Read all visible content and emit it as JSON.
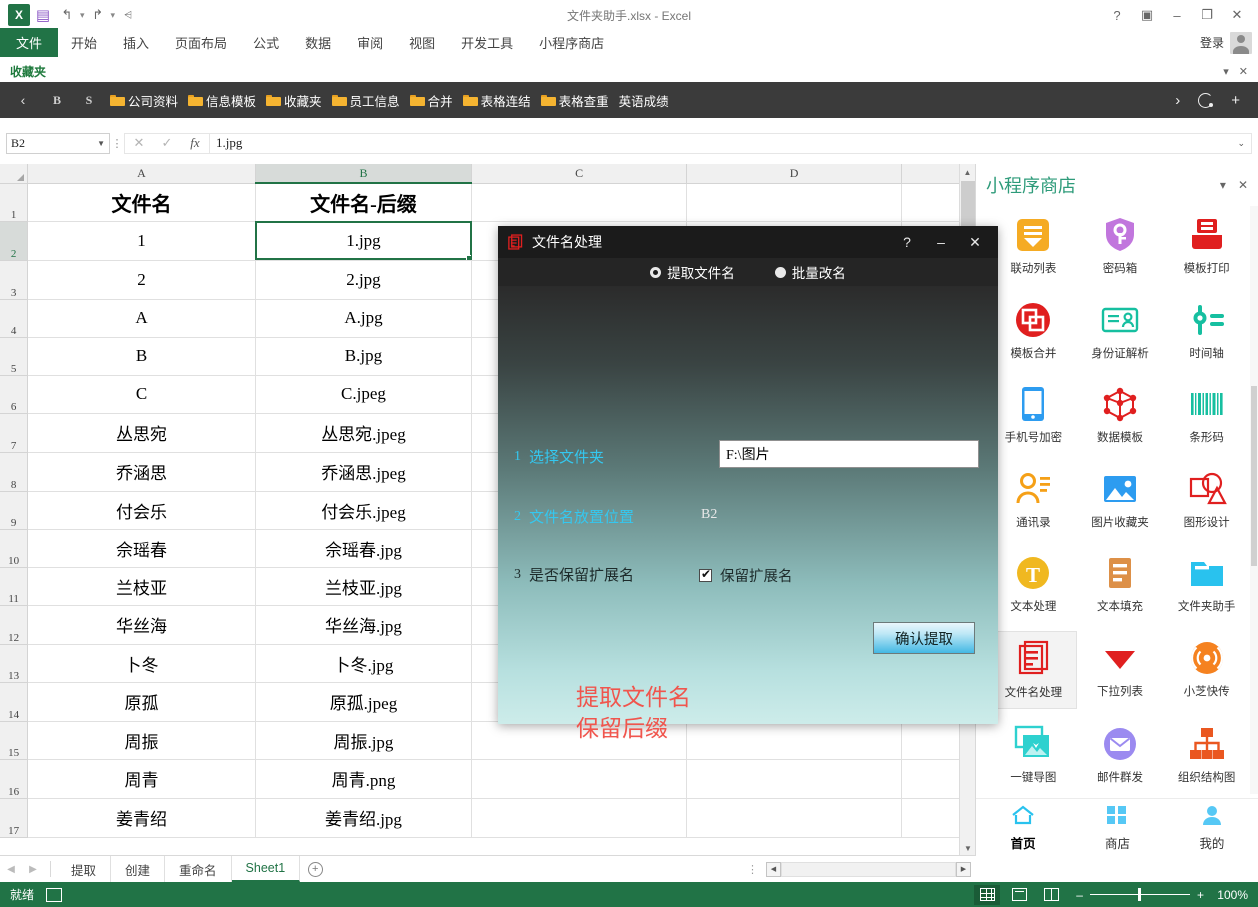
{
  "window": {
    "title": "文件夹助手.xlsx - Excel",
    "quick_access": [
      "save-icon",
      "undo-icon",
      "redo-icon",
      "customize-icon"
    ],
    "controls": {
      "help": "?",
      "ribbon_display": "▣",
      "minimize": "–",
      "restore": "❐",
      "close": "✕"
    }
  },
  "ribbon": {
    "tabs": [
      "文件",
      "开始",
      "插入",
      "页面布局",
      "公式",
      "数据",
      "审阅",
      "视图",
      "开发工具",
      "小程序商店"
    ],
    "active_tab": "文件",
    "signin_label": "登录"
  },
  "favorites": {
    "label": "收藏夹",
    "nav_back": "‹",
    "letters": [
      "B",
      "S"
    ],
    "items": [
      "公司资料",
      "信息模板",
      "收藏夹",
      "员工信息",
      "合并",
      "表格连结",
      "表格查重"
    ],
    "plain_item": "英语成绩",
    "nav_forward": "›",
    "refresh": "refresh-icon",
    "add": "+"
  },
  "formula_bar": {
    "name_box": "B2",
    "cancel": "✕",
    "enter": "✓",
    "fx": "fx",
    "content": "1.jpg",
    "expand_caret": "⌄"
  },
  "sheet": {
    "columns": [
      "A",
      "B",
      "C",
      "D"
    ],
    "selected_column": "B",
    "selected_row": "2",
    "selected_cell": "B2",
    "rows": [
      {
        "n": "1",
        "a": "文件名",
        "b": "文件名-后缀"
      },
      {
        "n": "2",
        "a": "1",
        "b": "1.jpg"
      },
      {
        "n": "3",
        "a": "2",
        "b": "2.jpg"
      },
      {
        "n": "4",
        "a": "A",
        "b": "A.jpg"
      },
      {
        "n": "5",
        "a": "B",
        "b": "B.jpg"
      },
      {
        "n": "6",
        "a": "C",
        "b": "C.jpeg"
      },
      {
        "n": "7",
        "a": "丛思宛",
        "b": "丛思宛.jpeg"
      },
      {
        "n": "8",
        "a": "乔涵思",
        "b": "乔涵思.jpeg"
      },
      {
        "n": "9",
        "a": "付会乐",
        "b": "付会乐.jpeg"
      },
      {
        "n": "10",
        "a": "佘瑶春",
        "b": "佘瑶春.jpg"
      },
      {
        "n": "11",
        "a": "兰枝亚",
        "b": "兰枝亚.jpg"
      },
      {
        "n": "12",
        "a": "华丝海",
        "b": "华丝海.jpg"
      },
      {
        "n": "13",
        "a": "卜冬",
        "b": "卜冬.jpg"
      },
      {
        "n": "14",
        "a": "原孤",
        "b": "原孤.jpeg"
      },
      {
        "n": "15",
        "a": "周振",
        "b": "周振.jpg"
      },
      {
        "n": "16",
        "a": "周青",
        "b": "周青.png"
      },
      {
        "n": "17",
        "a": "姜青绍",
        "b": "姜青绍.jpg"
      }
    ]
  },
  "sheet_tabs": {
    "tabs": [
      "提取",
      "创建",
      "重命名",
      "Sheet1"
    ],
    "active": "Sheet1",
    "add_label": "+"
  },
  "status_bar": {
    "ready": "就绪",
    "macro_icon": "record-macro-icon",
    "views": [
      "normal-view",
      "page-layout-view",
      "page-break-view"
    ],
    "active_view": "normal-view",
    "zoom_minus": "–",
    "zoom_plus": "+",
    "zoom_level": "100%"
  },
  "task_pane": {
    "title": "小程序商店",
    "menu_icon": "▾",
    "close_icon": "✕",
    "apps": [
      {
        "label": "联动列表",
        "icon": "linked-list-icon",
        "selected": false
      },
      {
        "label": "密码箱",
        "icon": "password-box-icon",
        "selected": false
      },
      {
        "label": "模板打印",
        "icon": "template-print-icon",
        "selected": false
      },
      {
        "label": "模板合并",
        "icon": "template-merge-icon",
        "selected": false
      },
      {
        "label": "身份证解析",
        "icon": "id-card-icon",
        "selected": false
      },
      {
        "label": "时间轴",
        "icon": "timeline-icon",
        "selected": false
      },
      {
        "label": "手机号加密",
        "icon": "phone-encrypt-icon",
        "selected": false
      },
      {
        "label": "数据模板",
        "icon": "data-template-icon",
        "selected": false
      },
      {
        "label": "条形码",
        "icon": "barcode-icon",
        "selected": false
      },
      {
        "label": "通讯录",
        "icon": "contacts-icon",
        "selected": false
      },
      {
        "label": "图片收藏夹",
        "icon": "image-favorites-icon",
        "selected": false
      },
      {
        "label": "图形设计",
        "icon": "graphic-design-icon",
        "selected": false
      },
      {
        "label": "文本处理",
        "icon": "text-process-icon",
        "selected": false
      },
      {
        "label": "文本填充",
        "icon": "text-fill-icon",
        "selected": false
      },
      {
        "label": "文件夹助手",
        "icon": "folder-helper-icon",
        "selected": false
      },
      {
        "label": "文件名处理",
        "icon": "filename-process-icon",
        "selected": true
      },
      {
        "label": "下拉列表",
        "icon": "dropdown-list-icon",
        "selected": false
      },
      {
        "label": "小芝快传",
        "icon": "quick-transfer-icon",
        "selected": false
      },
      {
        "label": "一键导图",
        "icon": "one-click-map-icon",
        "selected": false
      },
      {
        "label": "邮件群发",
        "icon": "mail-merge-icon",
        "selected": false
      },
      {
        "label": "组织结构图",
        "icon": "org-chart-icon",
        "selected": false
      }
    ],
    "bottom_nav": [
      {
        "label": "首页",
        "icon": "home-icon",
        "active": true
      },
      {
        "label": "商店",
        "icon": "store-icon",
        "active": false
      },
      {
        "label": "我的",
        "icon": "profile-icon",
        "active": false
      }
    ]
  },
  "dialog": {
    "title": "文件名处理",
    "icon": "filename-process-icon",
    "help": "?",
    "minimize": "–",
    "close": "✕",
    "modes": [
      {
        "label": "提取文件名",
        "selected": true
      },
      {
        "label": "批量改名",
        "selected": false
      }
    ],
    "steps": [
      {
        "num": "1",
        "label": "选择文件夹"
      },
      {
        "num": "2",
        "label": "文件名放置位置"
      },
      {
        "num": "3",
        "label": "是否保留扩展名"
      }
    ],
    "folder_path": "F:\\图片",
    "target_cell": "B2",
    "keep_ext_label": "保留扩展名",
    "keep_ext_checked": true,
    "confirm_label": "确认提取",
    "note_lines": [
      "提取文件名",
      "保留后缀"
    ],
    "colors": {
      "accent_cyan": "#34c8f0",
      "note_red": "#f0554d"
    }
  }
}
